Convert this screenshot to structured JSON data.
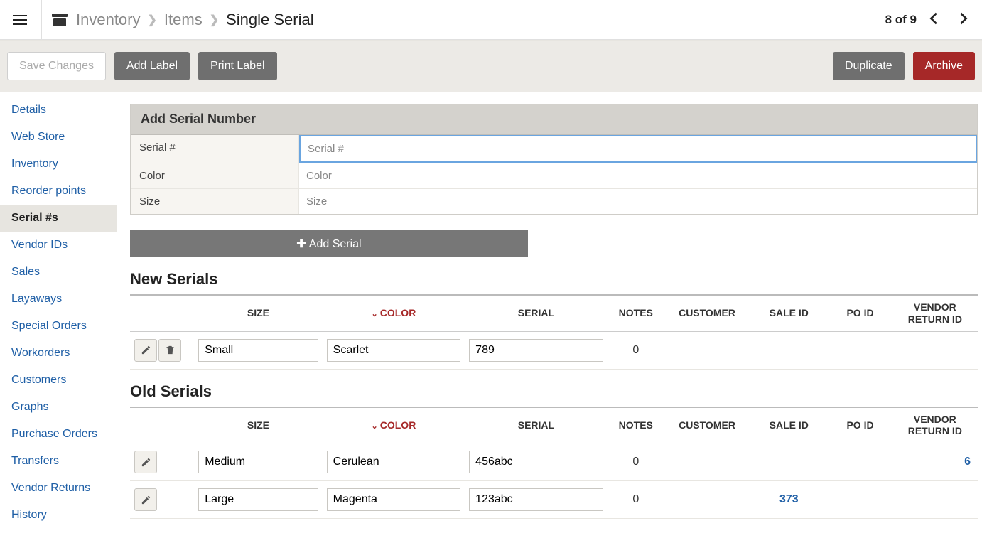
{
  "breadcrumbs": {
    "root": "Inventory",
    "mid": "Items",
    "current": "Single Serial"
  },
  "pager": {
    "text": "8 of 9"
  },
  "actions": {
    "save": "Save Changes",
    "add_label": "Add Label",
    "print_label": "Print Label",
    "duplicate": "Duplicate",
    "archive": "Archive"
  },
  "sidebar": {
    "items": [
      {
        "label": "Details"
      },
      {
        "label": "Web Store"
      },
      {
        "label": "Inventory"
      },
      {
        "label": "Reorder points"
      },
      {
        "label": "Serial #s",
        "active": true
      },
      {
        "label": "Vendor IDs"
      },
      {
        "label": "Sales"
      },
      {
        "label": "Layaways"
      },
      {
        "label": "Special Orders"
      },
      {
        "label": "Workorders"
      },
      {
        "label": "Customers"
      },
      {
        "label": "Graphs"
      },
      {
        "label": "Purchase Orders"
      },
      {
        "label": "Transfers"
      },
      {
        "label": "Vendor Returns"
      },
      {
        "label": "History"
      }
    ]
  },
  "panel": {
    "title": "Add Serial Number",
    "fields": {
      "serial": {
        "label": "Serial #",
        "placeholder": "Serial #"
      },
      "color": {
        "label": "Color",
        "placeholder": "Color"
      },
      "size": {
        "label": "Size",
        "placeholder": "Size"
      }
    },
    "add_button": "Add Serial"
  },
  "tables": {
    "headers": {
      "size": "SIZE",
      "color": "COLOR",
      "serial": "SERIAL",
      "notes": "NOTES",
      "customer": "CUSTOMER",
      "sale_id": "SALE ID",
      "po_id": "PO ID",
      "vri": "VENDOR RETURN ID"
    },
    "new_title": "New Serials",
    "old_title": "Old Serials",
    "new_rows": [
      {
        "size": "Small",
        "color": "Scarlet",
        "serial": "789",
        "notes": "0",
        "customer": "",
        "sale_id": "",
        "po_id": "",
        "vri": "",
        "deletable": true
      }
    ],
    "old_rows": [
      {
        "size": "Medium",
        "color": "Cerulean",
        "serial": "456abc",
        "notes": "0",
        "customer": "",
        "sale_id": "",
        "po_id": "",
        "vri": "6",
        "vri_link": true
      },
      {
        "size": "Large",
        "color": "Magenta",
        "serial": "123abc",
        "notes": "0",
        "customer": "",
        "sale_id": "373",
        "sale_id_link": true,
        "po_id": "",
        "vri": ""
      }
    ]
  }
}
